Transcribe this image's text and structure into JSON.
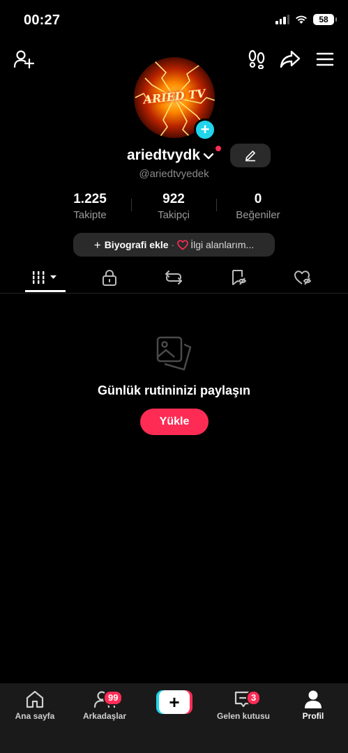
{
  "status_bar": {
    "time": "00:27",
    "battery": "58"
  },
  "header": {
    "add_friend_icon": "person-plus-icon",
    "footprint_icon": "footprints-icon",
    "share_icon": "share-arrow-icon",
    "menu_icon": "hamburger-menu-icon"
  },
  "profile": {
    "avatar_text": "ARIED TV",
    "username": "ariedtvydk",
    "handle": "@ariedtvyedek"
  },
  "stats": [
    {
      "value": "1.225",
      "label": "Takipte"
    },
    {
      "value": "922",
      "label": "Takipçi"
    },
    {
      "value": "0",
      "label": "Beğeniler"
    }
  ],
  "bio": {
    "add_label": "Biyografi ekle",
    "separator": "·",
    "interests_label": "İlgi alanlarım..."
  },
  "tabs": [
    "videos-grid-icon",
    "lock-icon",
    "repost-icon",
    "bookmark-icon",
    "liked-heart-icon"
  ],
  "empty_state": {
    "message": "Günlük rutininizi paylaşın",
    "button": "Yükle"
  },
  "bottom_nav": {
    "home": {
      "label": "Ana sayfa"
    },
    "friends": {
      "label": "Arkadaşlar",
      "badge": "99"
    },
    "create": {
      "label": "+"
    },
    "inbox": {
      "label": "Gelen kutusu",
      "badge": "3"
    },
    "profile": {
      "label": "Profil"
    }
  },
  "colors": {
    "accent": "#fe2c55",
    "cyan": "#20d5ec",
    "background": "#000000",
    "nav_background": "#1a1a1a"
  }
}
